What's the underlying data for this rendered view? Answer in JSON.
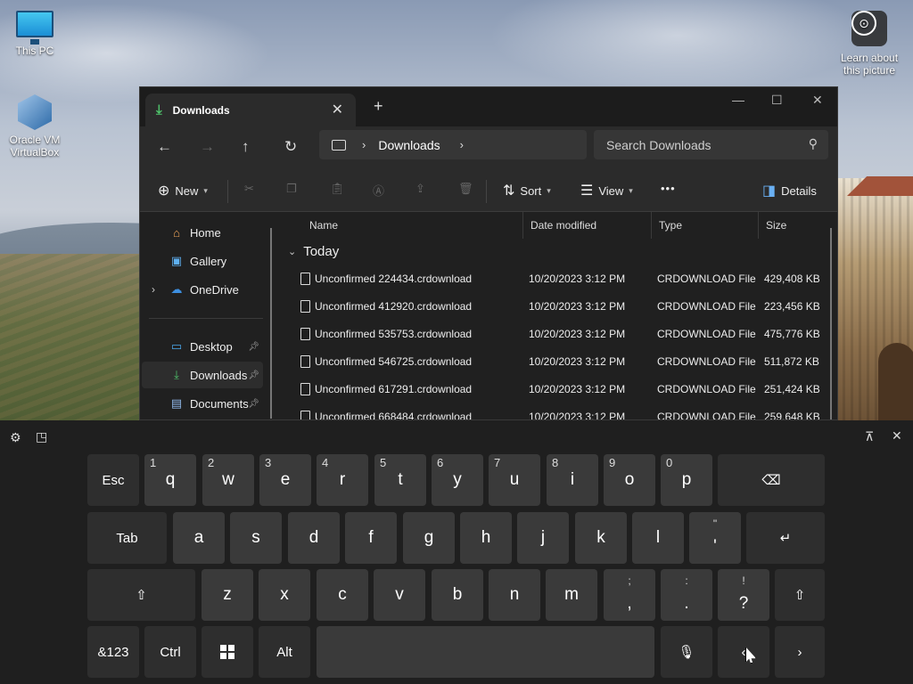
{
  "desktop": {
    "icons": [
      {
        "label": "This PC",
        "icon": "monitor-icon"
      },
      {
        "label": "Oracle VM VirtualBox",
        "icon": "virtualbox-icon"
      },
      {
        "label": "Learn about this picture",
        "icon": "camera-icon"
      }
    ]
  },
  "explorer": {
    "tab_title": "Downloads",
    "new_tab": "+",
    "address": {
      "segment": "Downloads"
    },
    "search_placeholder": "Search Downloads",
    "commands": {
      "new": "New",
      "sort": "Sort",
      "view": "View",
      "more": "•••",
      "details": "Details"
    },
    "nav": [
      {
        "label": "Home",
        "icon": "home-icon"
      },
      {
        "label": "Gallery",
        "icon": "gallery-icon"
      },
      {
        "label": "OneDrive",
        "icon": "cloud-icon"
      },
      {
        "label": "Desktop",
        "icon": "desktop-folder-icon",
        "pinned": true
      },
      {
        "label": "Downloads",
        "icon": "download-icon",
        "pinned": true,
        "selected": true
      },
      {
        "label": "Documents",
        "icon": "documents-icon",
        "pinned": true
      }
    ],
    "columns": [
      "Name",
      "Date modified",
      "Type",
      "Size"
    ],
    "group": "Today",
    "files": [
      {
        "name": "Unconfirmed 224434.crdownload",
        "date": "10/20/2023 3:12 PM",
        "type": "CRDOWNLOAD File",
        "size": "429,408 KB"
      },
      {
        "name": "Unconfirmed 412920.crdownload",
        "date": "10/20/2023 3:12 PM",
        "type": "CRDOWNLOAD File",
        "size": "223,456 KB"
      },
      {
        "name": "Unconfirmed 535753.crdownload",
        "date": "10/20/2023 3:12 PM",
        "type": "CRDOWNLOAD File",
        "size": "475,776 KB"
      },
      {
        "name": "Unconfirmed 546725.crdownload",
        "date": "10/20/2023 3:12 PM",
        "type": "CRDOWNLOAD File",
        "size": "511,872 KB"
      },
      {
        "name": "Unconfirmed 617291.crdownload",
        "date": "10/20/2023 3:12 PM",
        "type": "CRDOWNLOAD File",
        "size": "251,424 KB"
      },
      {
        "name": "Unconfirmed 668484.crdownload",
        "date": "10/20/2023 3:12 PM",
        "type": "CRDOWNLOAD File",
        "size": "259,648 KB"
      }
    ]
  },
  "keyboard": {
    "row1": [
      {
        "label": "Esc"
      },
      {
        "label": "q",
        "hint": "1"
      },
      {
        "label": "w",
        "hint": "2"
      },
      {
        "label": "e",
        "hint": "3"
      },
      {
        "label": "r",
        "hint": "4"
      },
      {
        "label": "t",
        "hint": "5"
      },
      {
        "label": "y",
        "hint": "6"
      },
      {
        "label": "u",
        "hint": "7"
      },
      {
        "label": "i",
        "hint": "8"
      },
      {
        "label": "o",
        "hint": "9"
      },
      {
        "label": "p",
        "hint": "0"
      }
    ],
    "row2": [
      {
        "label": "Tab"
      },
      {
        "label": "a"
      },
      {
        "label": "s"
      },
      {
        "label": "d"
      },
      {
        "label": "f"
      },
      {
        "label": "g"
      },
      {
        "label": "h"
      },
      {
        "label": "j"
      },
      {
        "label": "k"
      },
      {
        "label": "l"
      },
      {
        "label": "'",
        "up": "\""
      }
    ],
    "row3": [
      {
        "label": "z"
      },
      {
        "label": "x"
      },
      {
        "label": "c"
      },
      {
        "label": "v"
      },
      {
        "label": "b"
      },
      {
        "label": "n"
      },
      {
        "label": "m"
      },
      {
        "label": ",",
        "up": ";"
      },
      {
        "label": ".",
        "up": ":"
      },
      {
        "label": "?",
        "up": "!"
      }
    ],
    "row4": [
      {
        "label": "&123"
      },
      {
        "label": "Ctrl"
      },
      {
        "label": "Alt"
      }
    ]
  }
}
